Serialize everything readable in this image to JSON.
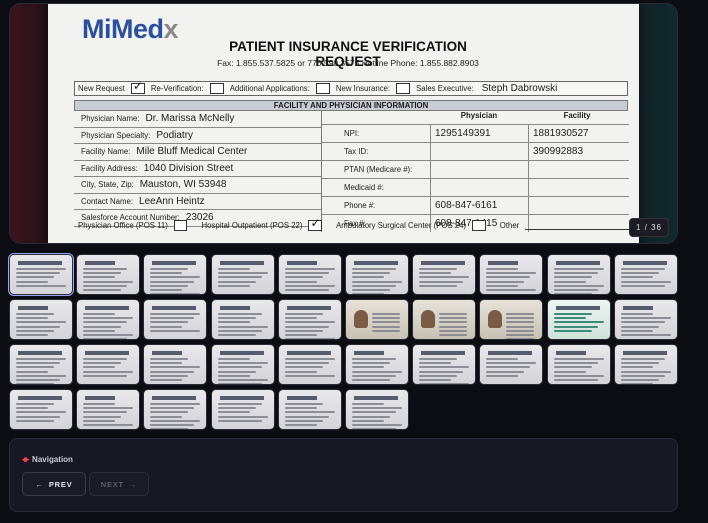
{
  "document": {
    "logo_main": "MiMed",
    "logo_x": "x",
    "title": "PATIENT INSURANCE VERIFICATION REQUEST",
    "contact_line": "Fax: 1.855.537.5825 or 770.590.3575      Hotline Phone: 1.855.882.8903",
    "request_options": {
      "new_request": "New Request",
      "re_verification": "Re-Verification:",
      "additional_applications": "Additional Applications:",
      "new_insurance": "New Insurance:",
      "sales_executive_label": "Sales Executive:",
      "sales_executive_value": "Steph Dabrowski"
    },
    "section_header": "FACILITY AND PHYSICIAN INFORMATION",
    "fields": [
      {
        "label": "Physician Name:",
        "value": "Dr. Marissa McNelly"
      },
      {
        "label": "Physician Specialty:",
        "value": "Podiatry"
      },
      {
        "label": "Facility Name:",
        "value": "Mile Bluff Medical Center"
      },
      {
        "label": "Facility Address:",
        "value": "1040 Division Street"
      },
      {
        "label": "City, State, Zip:",
        "value": "Mauston, WI 53948"
      },
      {
        "label": "Contact Name:",
        "value": "LeeAnn Heintz"
      },
      {
        "label": "Salesforce Account Number:",
        "value": "23026"
      }
    ],
    "right_table": {
      "col_physician": "Physician",
      "col_facility": "Facility",
      "rows": [
        {
          "label": "NPI:",
          "physician": "1295149391",
          "facility": "1881930527"
        },
        {
          "label": "Tax ID:",
          "physician": "",
          "facility": "390992883"
        },
        {
          "label": "PTAN (Medicare #):",
          "physician": "",
          "facility": ""
        },
        {
          "label": "Medicaid #:",
          "physician": "",
          "facility": ""
        },
        {
          "label": "Phone #:",
          "physician": "608-847-6161",
          "facility": ""
        },
        {
          "label": "Fax #:",
          "physician": "608-847-1415",
          "facility": ""
        }
      ]
    },
    "pos": {
      "office": "Physician Office (POS 11)",
      "outpatient": "Hospital Outpatient (POS 22)",
      "asc": "Ambulatory Surgical Center (POS 24)",
      "other": "Other"
    }
  },
  "viewer": {
    "counter": "1 / 36"
  },
  "thumbnails": {
    "count": 36,
    "active_index": 0
  },
  "navigation": {
    "title": "Navigation",
    "icon": "double-arrow-icon",
    "prev_label": "PREV",
    "next_label": "NEXT",
    "accent_color": "#ff4050"
  }
}
